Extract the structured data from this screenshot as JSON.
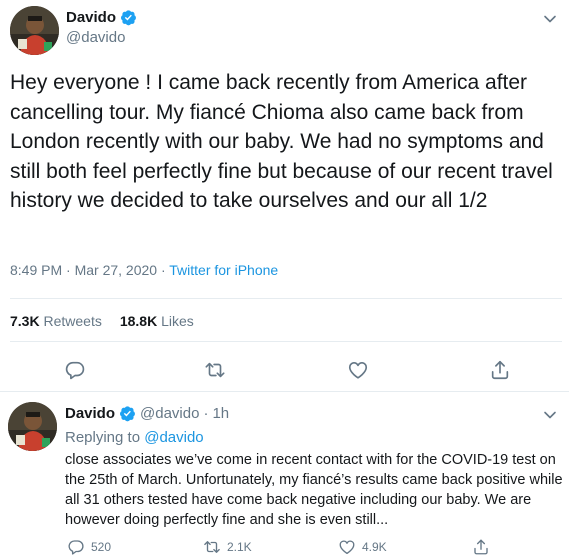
{
  "colors": {
    "text": "#14171a",
    "secondary": "#657786",
    "link": "#1b95e0",
    "verified": "#1da1f2",
    "divider": "#e6ecf0"
  },
  "main_tweet": {
    "display_name": "Davido",
    "handle": "@davido",
    "text": "Hey everyone ! I came back recently from America after cancelling tour. My fiancé Chioma also came back from London recently with our baby. We had no symptoms and still both feel perfectly fine but because of our recent travel history we decided to take ourselves and our all 1/2",
    "time": "8:49 PM · Mar 27, 2020 · ",
    "source": "Twitter for iPhone",
    "retweets_count": "7.3K",
    "retweets_label": "Retweets",
    "likes_count": "18.8K",
    "likes_label": "Likes",
    "icons": [
      "verified-badge-icon",
      "chevron-down-icon",
      "reply-icon",
      "retweet-icon",
      "like-icon",
      "share-icon"
    ]
  },
  "reply_tweet": {
    "display_name": "Davido",
    "handle": "@davido",
    "separator": "·",
    "time": "1h",
    "replying_prefix": "Replying to ",
    "replying_to": "@davido",
    "text": "close associates we’ve come in recent contact with for the COVID-19 test on the 25th of March. Unfortunately, my fiancé’s results came back positive while all 31 others tested have come back negative including our baby. We are however doing perfectly fine and she is even still...",
    "reply_count": "520",
    "retweet_count": "2.1K",
    "like_count": "4.9K"
  }
}
